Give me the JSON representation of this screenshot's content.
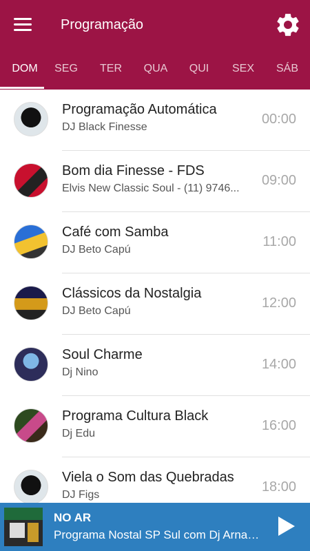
{
  "header": {
    "title": "Programação"
  },
  "tabs": [
    {
      "label": "DOM",
      "active": true
    },
    {
      "label": "SEG"
    },
    {
      "label": "TER"
    },
    {
      "label": "QUA"
    },
    {
      "label": "QUI"
    },
    {
      "label": "SEX"
    },
    {
      "label": "SÁB"
    }
  ],
  "schedule": [
    {
      "title": "Programação Automática",
      "host": "DJ Black Finesse",
      "time": "00:00"
    },
    {
      "title": "Bom dia Finesse - FDS",
      "host": "Elvis New Classic Soul - (11) 9746...",
      "time": "09:00"
    },
    {
      "title": "Café com Samba",
      "host": "DJ Beto Capú",
      "time": "11:00"
    },
    {
      "title": "Clássicos da Nostalgia",
      "host": "DJ Beto Capú",
      "time": "12:00"
    },
    {
      "title": "Soul Charme",
      "host": "Dj Nino",
      "time": "14:00"
    },
    {
      "title": "Programa Cultura Black",
      "host": "Dj Edu",
      "time": "16:00"
    },
    {
      "title": "Viela o Som das Quebradas",
      "host": "DJ Figs",
      "time": "18:00"
    }
  ],
  "player": {
    "status": "NO AR",
    "now_playing": "Programa Nostal SP Sul com Dj Arnaldo"
  },
  "colors": {
    "primary": "#9c1445",
    "player": "#2e7fbf"
  }
}
